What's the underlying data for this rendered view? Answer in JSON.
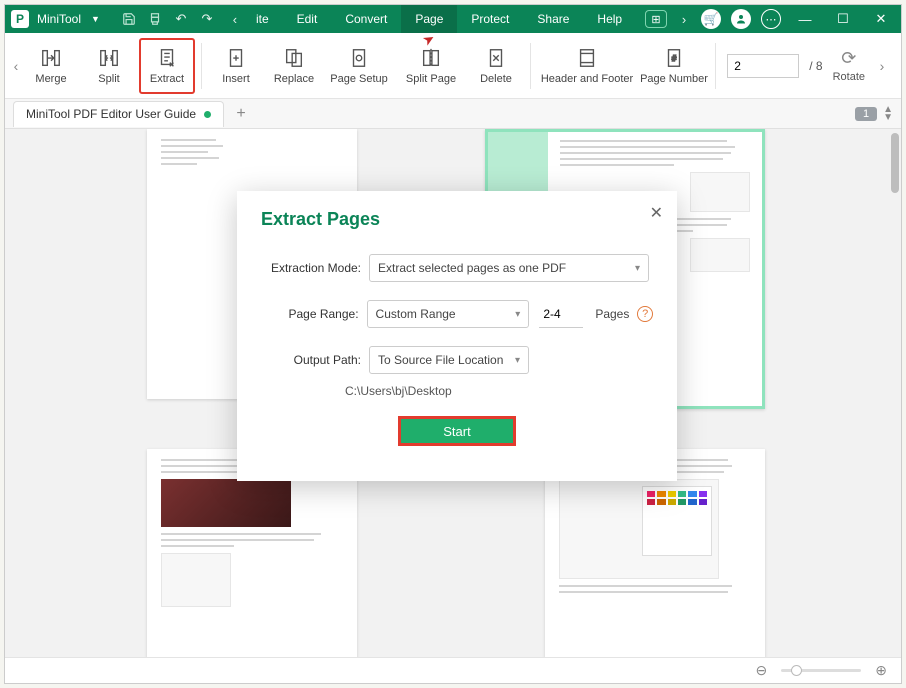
{
  "brand": "MiniTool",
  "menu": [
    "ite",
    "Edit",
    "Convert",
    "Page",
    "Protect",
    "Share",
    "Help"
  ],
  "menu_active_index": 3,
  "ribbon": {
    "merge": "Merge",
    "split": "Split",
    "extract": "Extract",
    "insert": "Insert",
    "replace": "Replace",
    "page_setup": "Page Setup",
    "split_page": "Split Page",
    "delete": "Delete",
    "header_footer": "Header and Footer",
    "page_number": "Page Number",
    "rotate": "Rotate",
    "page_current": "2",
    "page_total": "/ 8"
  },
  "tab": {
    "title": "MiniTool PDF Editor User Guide",
    "page_badge": "1"
  },
  "dialog": {
    "title": "Extract Pages",
    "mode_label": "Extraction Mode:",
    "mode_value": "Extract selected pages as one PDF",
    "range_label": "Page Range:",
    "range_value": "Custom Range",
    "range_input": "2-4",
    "pages_label": "Pages",
    "output_label": "Output Path:",
    "output_value": "To Source File Location",
    "path": "C:\\Users\\bj\\Desktop",
    "start": "Start"
  }
}
